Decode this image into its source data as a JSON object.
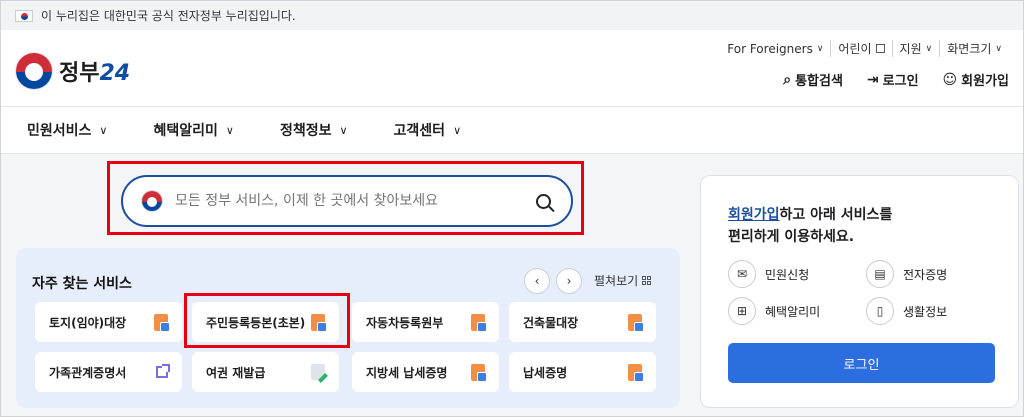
{
  "banner": {
    "text": "이 누리집은 대한민국 공식 전자정부 누리집입니다."
  },
  "logo": {
    "text": "정부",
    "num": "24"
  },
  "util_links": {
    "foreigners": "For Foreigners",
    "children": "어린이",
    "support": "지원",
    "screen_size": "화면크기"
  },
  "main_actions": {
    "search": "통합검색",
    "login": "로그인",
    "signup": "회원가입"
  },
  "nav": [
    {
      "label": "민원서비스"
    },
    {
      "label": "혜택알리미"
    },
    {
      "label": "정책정보"
    },
    {
      "label": "고객센터"
    }
  ],
  "search": {
    "placeholder": "모든 정부 서비스, 이제 한 곳에서 찾아보세요"
  },
  "freq": {
    "title": "자주 찾는 서비스",
    "expand": "펼쳐보기",
    "cards": [
      {
        "label": "토지(임야)대장"
      },
      {
        "label": "주민등록등본(초본)"
      },
      {
        "label": "자동차등록원부"
      },
      {
        "label": "건축물대장"
      },
      {
        "label": "가족관계증명서"
      },
      {
        "label": "여권 재발급"
      },
      {
        "label": "지방세 납세증명"
      },
      {
        "label": "납세증명"
      }
    ]
  },
  "member": {
    "link": "회원가입",
    "line1_rest": "하고 아래 서비스를",
    "line2": "편리하게 이용하세요.",
    "services": [
      {
        "label": "민원신청"
      },
      {
        "label": "전자증명"
      },
      {
        "label": "혜택알리미"
      },
      {
        "label": "생활정보"
      }
    ],
    "login_button": "로그인"
  }
}
